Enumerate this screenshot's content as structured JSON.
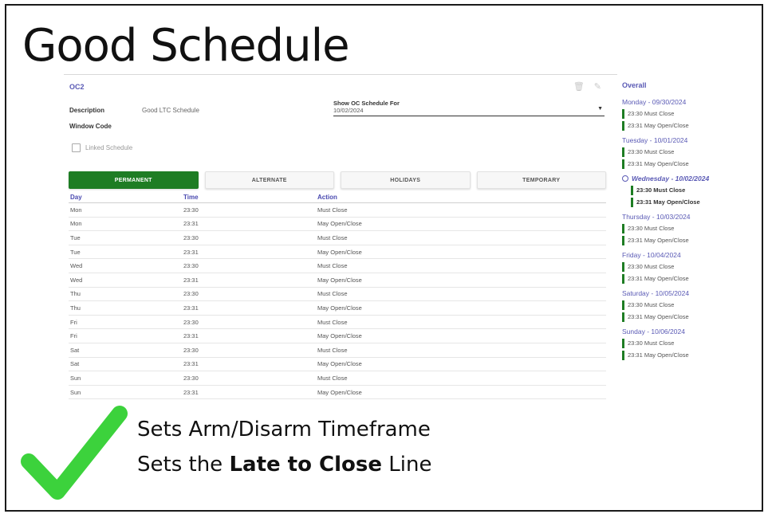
{
  "slide_title": "Good Schedule",
  "record": {
    "id": "OC2",
    "description_label": "Description",
    "description_value": "Good LTC Schedule",
    "window_code_label": "Window Code",
    "show_for_label": "Show OC Schedule For",
    "show_for_value": "10/02/2024",
    "linked_label": "Linked Schedule",
    "linked_checked": false
  },
  "icons": {
    "delete": "trash-icon",
    "edit": "pencil-icon",
    "dropdown": "caret-down-icon",
    "current": "circle-icon",
    "check": "checkmark-icon"
  },
  "tabs": [
    {
      "label": "PERMANENT",
      "active": true
    },
    {
      "label": "ALTERNATE",
      "active": false
    },
    {
      "label": "HOLIDAYS",
      "active": false
    },
    {
      "label": "TEMPORARY",
      "active": false
    }
  ],
  "table": {
    "headers": [
      "Day",
      "Time",
      "Action"
    ],
    "rows": [
      [
        "Mon",
        "23:30",
        "Must Close"
      ],
      [
        "Mon",
        "23:31",
        "May Open/Close"
      ],
      [
        "Tue",
        "23:30",
        "Must Close"
      ],
      [
        "Tue",
        "23:31",
        "May Open/Close"
      ],
      [
        "Wed",
        "23:30",
        "Must Close"
      ],
      [
        "Wed",
        "23:31",
        "May Open/Close"
      ],
      [
        "Thu",
        "23:30",
        "Must Close"
      ],
      [
        "Thu",
        "23:31",
        "May Open/Close"
      ],
      [
        "Fri",
        "23:30",
        "Must Close"
      ],
      [
        "Fri",
        "23:31",
        "May Open/Close"
      ],
      [
        "Sat",
        "23:30",
        "Must Close"
      ],
      [
        "Sat",
        "23:31",
        "May Open/Close"
      ],
      [
        "Sun",
        "23:30",
        "Must Close"
      ],
      [
        "Sun",
        "23:31",
        "May Open/Close"
      ]
    ]
  },
  "overall": {
    "title": "Overall",
    "days": [
      {
        "title": "Monday - 09/30/2024",
        "current": false,
        "entries": [
          "23:30 Must Close",
          "23:31 May Open/Close"
        ]
      },
      {
        "title": "Tuesday - 10/01/2024",
        "current": false,
        "entries": [
          "23:30 Must Close",
          "23:31 May Open/Close"
        ]
      },
      {
        "title": "Wednesday - 10/02/2024",
        "current": true,
        "entries": [
          "23:30 Must Close",
          "23:31 May Open/Close"
        ]
      },
      {
        "title": "Thursday - 10/03/2024",
        "current": false,
        "entries": [
          "23:30 Must Close",
          "23:31 May Open/Close"
        ]
      },
      {
        "title": "Friday - 10/04/2024",
        "current": false,
        "entries": [
          "23:30 Must Close",
          "23:31 May Open/Close"
        ]
      },
      {
        "title": "Saturday - 10/05/2024",
        "current": false,
        "entries": [
          "23:30 Must Close",
          "23:31 May Open/Close"
        ]
      },
      {
        "title": "Sunday - 10/06/2024",
        "current": false,
        "entries": [
          "23:30 Must Close",
          "23:31 May Open/Close"
        ]
      }
    ]
  },
  "bullets": {
    "line1": "Sets Arm/Disarm Timeframe",
    "line2_prefix": "Sets the ",
    "line2_bold": "Late to Close",
    "line2_suffix": " Line"
  },
  "colors": {
    "accent_green": "#1e7d24",
    "header_blue": "#5a5ab5",
    "check_green": "#3cd23c"
  }
}
